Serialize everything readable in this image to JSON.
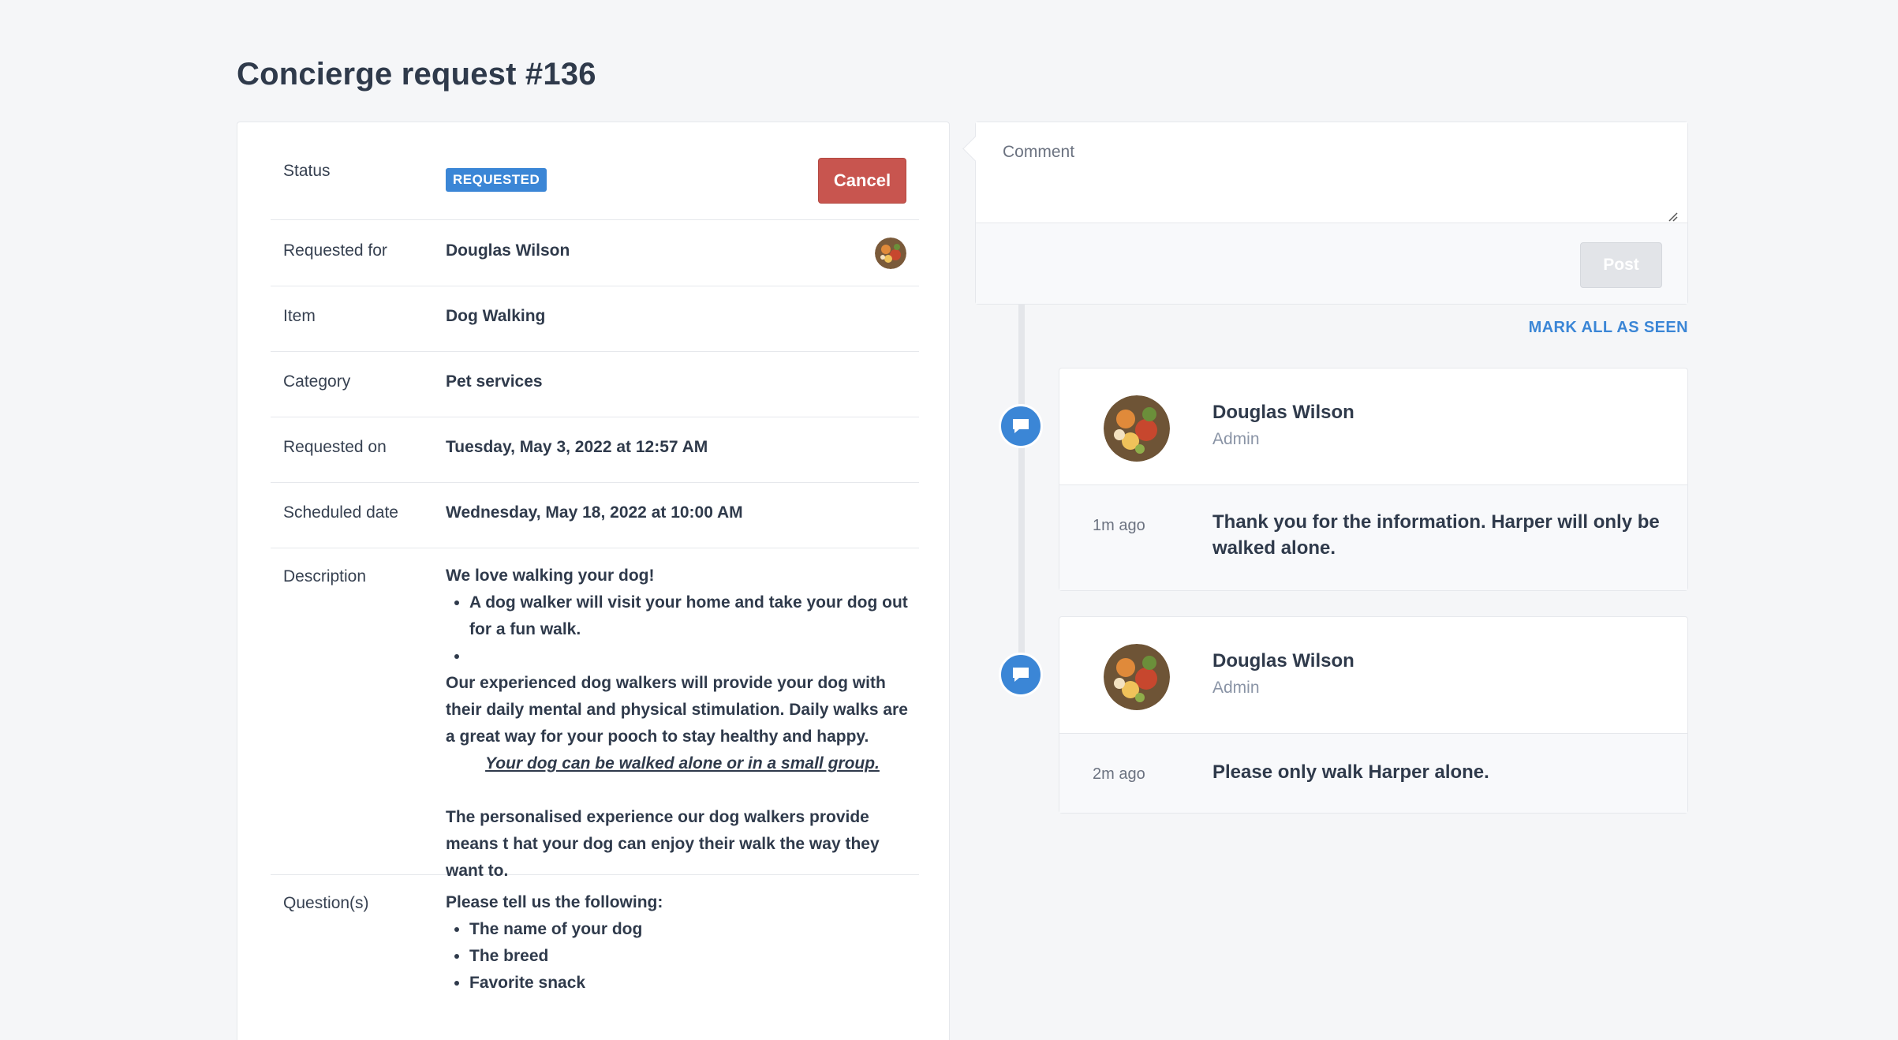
{
  "page": {
    "title": "Concierge request #136"
  },
  "details": {
    "status": {
      "label": "Status",
      "badge": "REQUESTED",
      "cancel_label": "Cancel"
    },
    "requested_for": {
      "label": "Requested for",
      "value": "Douglas Wilson"
    },
    "item": {
      "label": "Item",
      "value": "Dog Walking"
    },
    "category": {
      "label": "Category",
      "value": "Pet services"
    },
    "requested_on": {
      "label": "Requested on",
      "value": "Tuesday, May 3, 2022 at 12:57 AM"
    },
    "scheduled_date": {
      "label": "Scheduled date",
      "value": "Wednesday, May 18, 2022 at 10:00 AM"
    },
    "description": {
      "label": "Description",
      "intro": "We love walking your dog!",
      "bullet_1": "A dog walker will visit your home and take your dog out for a fun walk.",
      "bullet_2": "",
      "para_1": "Our experienced dog walkers will provide your dog with their daily mental and physical stimulation. Daily walks are a great way for your pooch to stay healthy and happy.",
      "emphasis": "Your dog can be walked alone or in a small group.",
      "para_2": "The personalised experience our dog walkers provide means t hat your dog can enjoy their walk the way they want to."
    },
    "questions": {
      "label": "Question(s)",
      "intro": "Please tell us the following:",
      "items": [
        "The name of your dog",
        "The breed",
        "Favorite snack"
      ]
    }
  },
  "comment": {
    "placeholder": "Comment",
    "post_label": "Post",
    "mark_all_seen": "MARK ALL AS SEEN"
  },
  "messages": [
    {
      "author": "Douglas Wilson",
      "role": "Admin",
      "time": "1m ago",
      "text": "Thank you for the information. Harper will only be walked alone."
    },
    {
      "author": "Douglas Wilson",
      "role": "Admin",
      "time": "2m ago",
      "text": "Please only walk Harper alone."
    }
  ],
  "colors": {
    "accent": "#3b86d6",
    "danger": "#c8554f",
    "background": "#f5f6f8"
  }
}
